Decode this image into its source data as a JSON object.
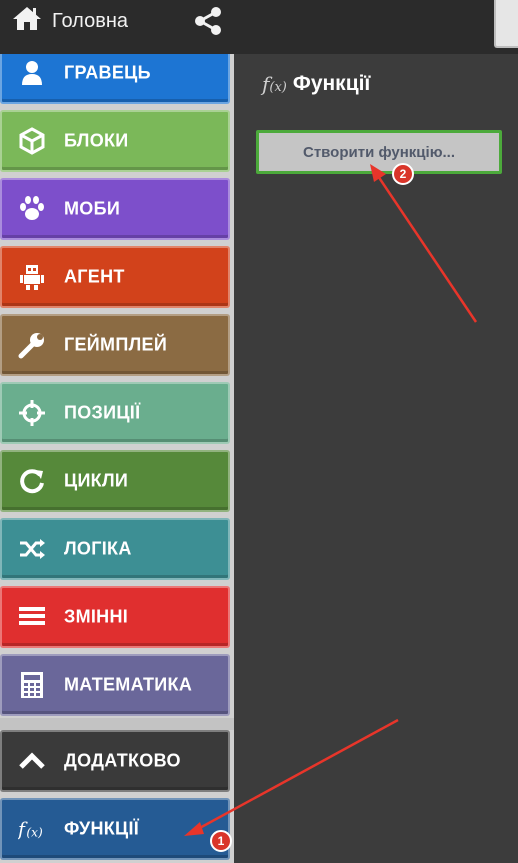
{
  "topbar": {
    "home_label": "Головна",
    "home_icon": "home-icon",
    "share_icon": "share-icon"
  },
  "categories": [
    {
      "label": "ГРАВЕЦЬ",
      "color": "#1d75d3",
      "icon": "person-icon"
    },
    {
      "label": "БЛОКИ",
      "color": "#7bb859",
      "icon": "cube-icon"
    },
    {
      "label": "МОБИ",
      "color": "#7d4fcb",
      "icon": "paw-icon"
    },
    {
      "label": "АГЕНТ",
      "color": "#d2421b",
      "icon": "robot-icon"
    },
    {
      "label": "ГЕЙМПЛЕЙ",
      "color": "#8b6b43",
      "icon": "wrench-icon"
    },
    {
      "label": "ПОЗИЦІЇ",
      "color": "#6aae8e",
      "icon": "crosshair-icon"
    },
    {
      "label": "ЦИКЛИ",
      "color": "#56893a",
      "icon": "loop-icon"
    },
    {
      "label": "ЛОГІКА",
      "color": "#3d8f94",
      "icon": "shuffle-icon"
    },
    {
      "label": "ЗМІННІ",
      "color": "#e02f2f",
      "icon": "list-icon"
    },
    {
      "label": "МАТЕМАТИКА",
      "color": "#6a679a",
      "icon": "calculator-icon"
    },
    {
      "label": "ДОДАТКОВО",
      "color": "#3a3a3a",
      "icon": "chevron-up-icon"
    },
    {
      "label": "ФУНКЦІЇ",
      "color": "#255b94",
      "icon": "function-icon"
    }
  ],
  "flyout": {
    "fx_symbol": "f",
    "fx_arg": "(x)",
    "title": "Функції",
    "create_button_label": "Створити функцію..."
  },
  "annotations": {
    "badge_1": "1",
    "badge_2": "2",
    "arrow_color": "#e8352a"
  }
}
